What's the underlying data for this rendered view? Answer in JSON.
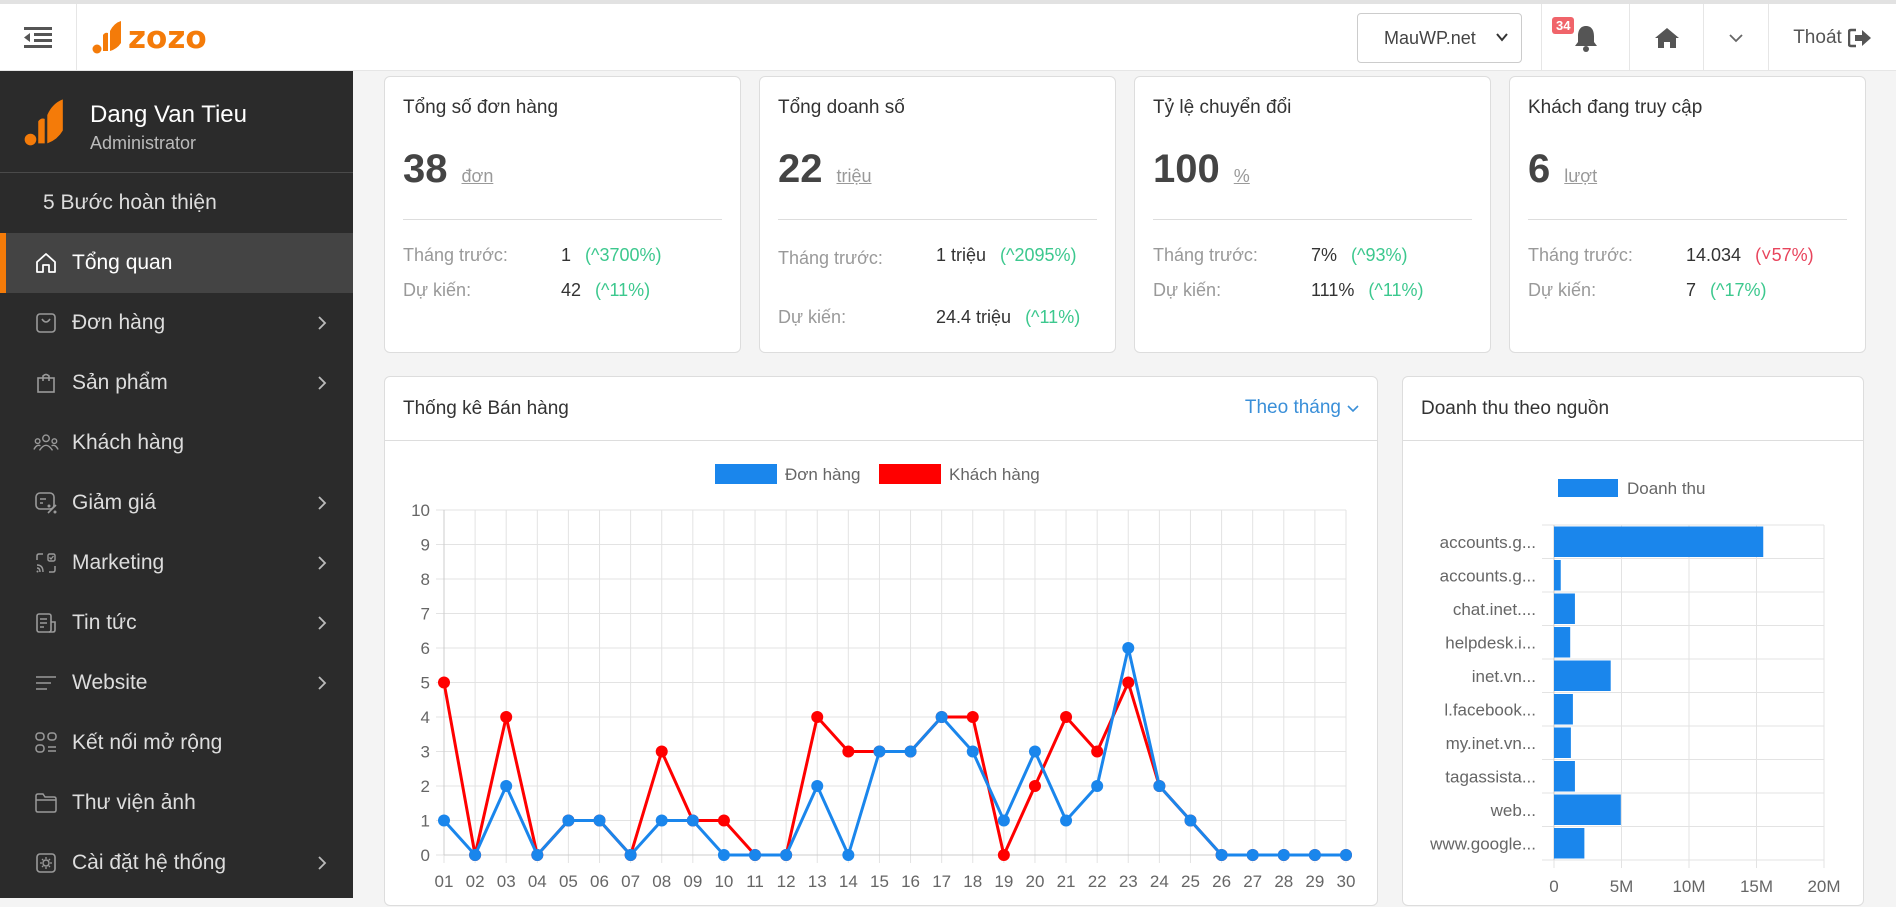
{
  "header": {
    "logo_text": "zozo",
    "site_select": "MauWP.net",
    "notification_count": "34",
    "logout_label": "Thoát"
  },
  "profile": {
    "name": "Dang Van Tieu",
    "role": "Administrator"
  },
  "sidebar": {
    "steps_label": "5 Bước hoàn thiện",
    "items": [
      {
        "label": "Tổng quan",
        "icon": "home-icon",
        "active": true,
        "has_arrow": false
      },
      {
        "label": "Đơn hàng",
        "icon": "order-icon",
        "active": false,
        "has_arrow": true
      },
      {
        "label": "Sản phẩm",
        "icon": "shopping-bag-icon",
        "active": false,
        "has_arrow": true
      },
      {
        "label": "Khách hàng",
        "icon": "users-icon",
        "active": false,
        "has_arrow": false
      },
      {
        "label": "Giảm giá",
        "icon": "discount-icon",
        "active": false,
        "has_arrow": true
      },
      {
        "label": "Marketing",
        "icon": "marketing-icon",
        "active": false,
        "has_arrow": true
      },
      {
        "label": "Tin tức",
        "icon": "news-icon",
        "active": false,
        "has_arrow": true
      },
      {
        "label": "Website",
        "icon": "website-lines-icon",
        "active": false,
        "has_arrow": true
      },
      {
        "label": "Kết nối mở rộng",
        "icon": "apps-icon",
        "active": false,
        "has_arrow": false
      },
      {
        "label": "Thư viện ảnh",
        "icon": "folder-icon",
        "active": false,
        "has_arrow": false
      },
      {
        "label": "Cài đặt hệ thống",
        "icon": "settings-icon",
        "active": false,
        "has_arrow": true
      }
    ]
  },
  "cards": [
    {
      "title": "Tổng số đơn hàng",
      "value": "38",
      "unit": "đơn",
      "prev_label": "Tháng trước:",
      "prev_value": "1",
      "prev_change": "(^3700%)",
      "prev_dir": "up",
      "fc_label": "Dự kiến:",
      "fc_value": "42",
      "fc_change": "(^11%)",
      "fc_dir": "up"
    },
    {
      "title": "Tổng doanh số",
      "value": "22",
      "unit": "triệu",
      "prev_label": "Tháng trước:",
      "prev_value": "1 triệu",
      "prev_change": "(^2095%)",
      "prev_dir": "up",
      "fc_label": "Dự kiến:",
      "fc_value": "24.4 triệu",
      "fc_change": "(^11%)",
      "fc_dir": "up"
    },
    {
      "title": "Tỷ lệ chuyển đổi",
      "value": "100",
      "unit": "%",
      "prev_label": "Tháng trước:",
      "prev_value": "7%",
      "prev_change": "(^93%)",
      "prev_dir": "up",
      "fc_label": "Dự kiến:",
      "fc_value": "111%",
      "fc_change": "(^11%)",
      "fc_dir": "up"
    },
    {
      "title": "Khách đang truy cập",
      "value": "6",
      "unit": "lượt",
      "prev_label": "Tháng trước:",
      "prev_value": "14.034",
      "prev_change": "(˅57%)",
      "prev_dir": "down",
      "fc_label": "Dự kiến:",
      "fc_value": "7",
      "fc_change": "(^17%)",
      "fc_dir": "up"
    }
  ],
  "sales_panel": {
    "title": "Thống kê Bán hàng",
    "period": "Theo tháng"
  },
  "source_panel": {
    "title": "Doanh thu theo nguồn"
  },
  "colors": {
    "accent": "#f47b09",
    "blue": "#1a86ec",
    "red": "#ff0000",
    "up": "#3cc88e",
    "down": "#e8445c"
  },
  "chart_data": [
    {
      "type": "line",
      "title": "Thống kê Bán hàng",
      "x": [
        "01",
        "02",
        "03",
        "04",
        "05",
        "06",
        "07",
        "08",
        "09",
        "10",
        "11",
        "12",
        "13",
        "14",
        "15",
        "16",
        "17",
        "18",
        "19",
        "20",
        "21",
        "22",
        "23",
        "24",
        "25",
        "26",
        "27",
        "28",
        "29",
        "30"
      ],
      "series": [
        {
          "name": "Đơn hàng",
          "color": "#1a86ec",
          "values": [
            1,
            0,
            2,
            0,
            1,
            1,
            0,
            1,
            1,
            0,
            0,
            0,
            2,
            0,
            3,
            3,
            4,
            3,
            1,
            3,
            1,
            2,
            6,
            2,
            1,
            0,
            0,
            0,
            0,
            0
          ]
        },
        {
          "name": "Khách hàng",
          "color": "#ff0000",
          "values": [
            5,
            0,
            4,
            0,
            1,
            1,
            0,
            3,
            1,
            1,
            0,
            0,
            4,
            3,
            3,
            3,
            4,
            4,
            0,
            2,
            4,
            3,
            5,
            2,
            1,
            0,
            0,
            0,
            0,
            0
          ]
        }
      ],
      "ylim": [
        0,
        10
      ],
      "yticks": [
        0,
        1,
        2,
        3,
        4,
        5,
        6,
        7,
        8,
        9,
        10
      ],
      "grid": true,
      "legend": "top-center"
    },
    {
      "type": "bar",
      "orientation": "horizontal",
      "title": "Doanh thu theo nguồn",
      "categories": [
        "accounts.g...",
        "accounts.g...",
        "chat.inet....",
        "helpdesk.i...",
        "inet.vn...",
        "l.facebook...",
        "my.inet.vn...",
        "tagassista...",
        "web...",
        "www.google..."
      ],
      "series": [
        {
          "name": "Doanh thu",
          "color": "#1a86ec",
          "values": [
            15500000,
            500000,
            1550000,
            1200000,
            4200000,
            1400000,
            1250000,
            1550000,
            4950000,
            2250000
          ]
        }
      ],
      "xlim": [
        0,
        20000000
      ],
      "xticks": [
        "0",
        "5M",
        "10M",
        "15M",
        "20M"
      ],
      "xtick_values": [
        0,
        5000000,
        10000000,
        15000000,
        20000000
      ],
      "grid": true,
      "legend": "top-center"
    }
  ]
}
